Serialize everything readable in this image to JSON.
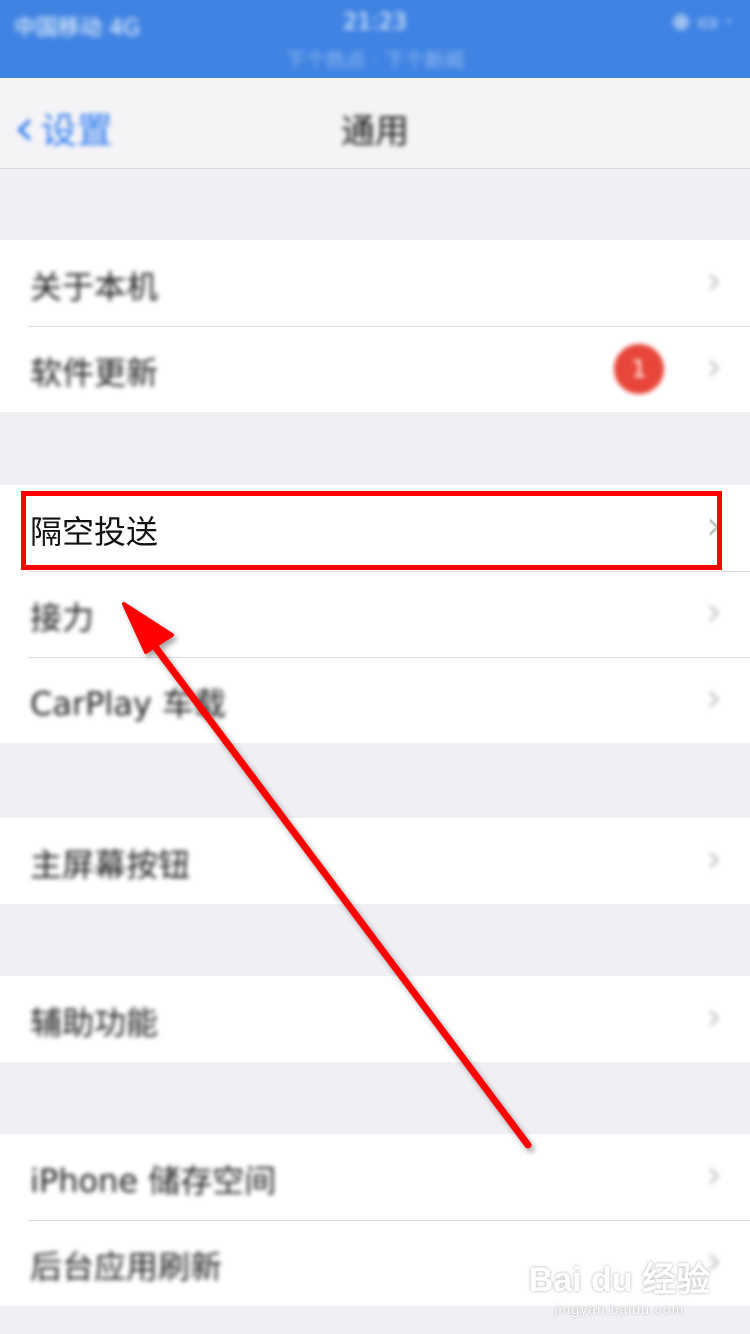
{
  "status_bar": {
    "carrier": "中国移动 4G",
    "time": "21:23",
    "subtitle": "下个热点 · 下个新闻",
    "right": "⊕ ▭ ·"
  },
  "nav": {
    "back_label": "设置",
    "title": "通用"
  },
  "groups": [
    {
      "rows": [
        {
          "label": "关于本机"
        },
        {
          "label": "软件更新",
          "badge": "1"
        }
      ]
    },
    {
      "rows": [
        {
          "label": "隔空投送"
        },
        {
          "label": "接力"
        },
        {
          "label": "CarPlay 车载"
        }
      ]
    },
    {
      "rows": [
        {
          "label": "主屏幕按钮"
        }
      ]
    },
    {
      "rows": [
        {
          "label": "辅助功能"
        }
      ]
    },
    {
      "rows": [
        {
          "label": "iPhone 储存空间"
        },
        {
          "label": "后台应用刷新"
        }
      ]
    }
  ],
  "chevron": "›",
  "annotation_color": "#ff0000",
  "watermark": {
    "main": "Bai du 经验",
    "sub": "jingyan.baidu.com"
  }
}
